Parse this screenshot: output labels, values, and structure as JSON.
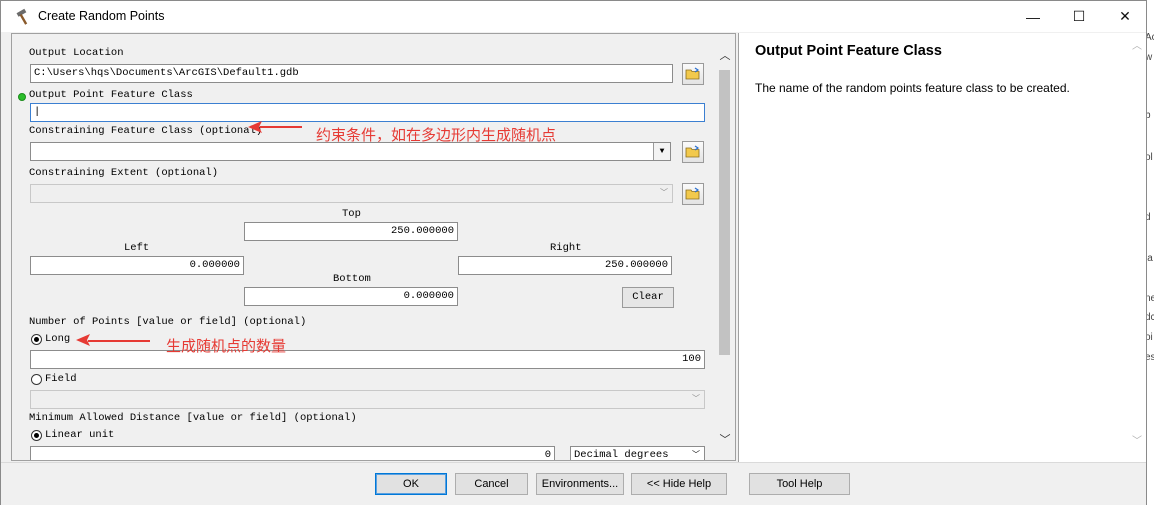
{
  "window": {
    "title": "Create Random Points",
    "controls": {
      "minimize": "—",
      "maximize": "☐",
      "close": "✕"
    }
  },
  "form": {
    "output_location": {
      "label": "Output Location",
      "value": "C:\\Users\\hqs\\Documents\\ArcGIS\\Default1.gdb"
    },
    "output_feature_class": {
      "label": "Output Point Feature Class",
      "value": "|"
    },
    "constraining_feature_class": {
      "label": "Constraining Feature Class (optional)",
      "value": ""
    },
    "constraining_extent": {
      "label": "Constraining Extent (optional)",
      "value": "",
      "top_label": "Top",
      "top_value": "250.000000",
      "left_label": "Left",
      "left_value": "0.000000",
      "right_label": "Right",
      "right_value": "250.000000",
      "bottom_label": "Bottom",
      "bottom_value": "0.000000",
      "clear_label": "Clear"
    },
    "number_of_points": {
      "label": "Number of Points [value or field] (optional)",
      "long_label": "Long",
      "long_value": "100",
      "field_label": "Field"
    },
    "min_distance": {
      "label": "Minimum Allowed Distance [value or field] (optional)",
      "linear_unit_label": "Linear unit",
      "linear_value": "0",
      "unit": "Decimal degrees"
    }
  },
  "annotations": {
    "constraint_note": "约束条件，如在多边形内生成随机点",
    "count_note": "生成随机点的数量",
    "color": "#e63a34"
  },
  "help": {
    "title": "Output Point Feature Class",
    "text": "The name of the random points feature class to be created."
  },
  "buttons": {
    "ok": "OK",
    "cancel": "Cancel",
    "environments": "Environments...",
    "hide_help": "<< Hide Help",
    "tool_help": "Tool Help"
  },
  "background_fragments": [
    "Ac",
    "w",
    "b",
    "ol",
    "d",
    "la",
    "ne",
    "dc",
    "oi",
    "es"
  ]
}
